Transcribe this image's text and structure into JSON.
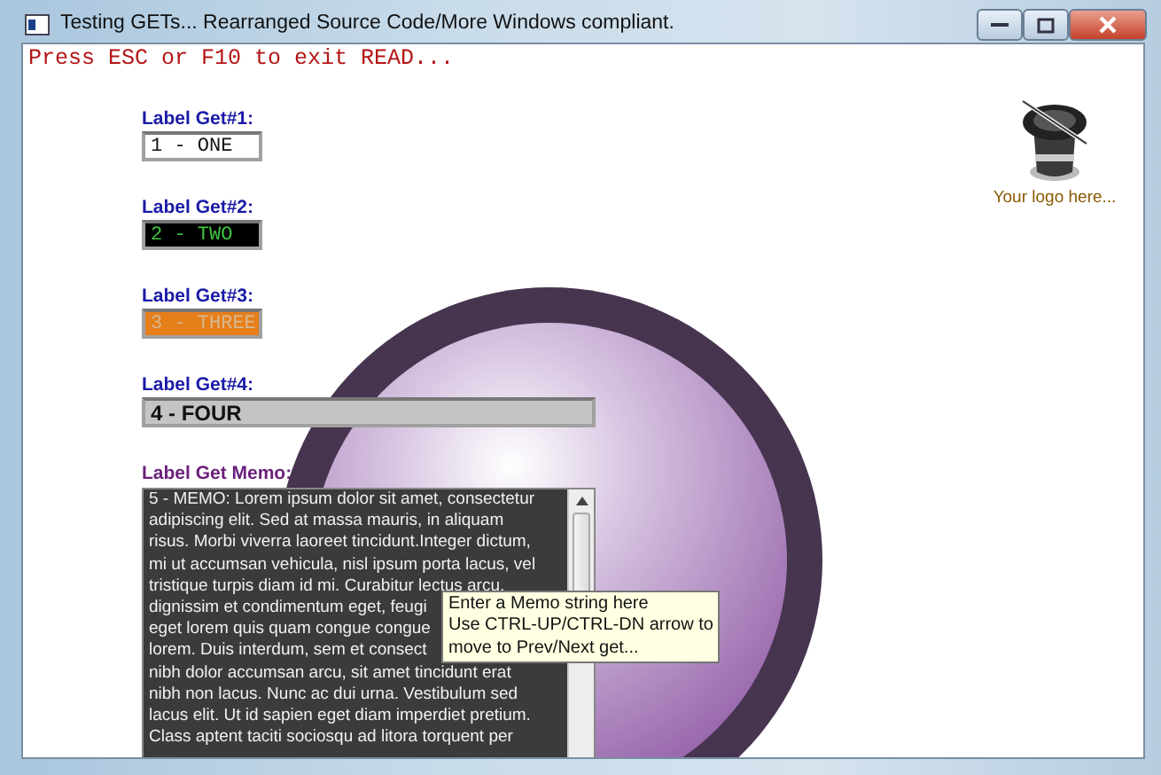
{
  "window": {
    "title": "Testing GETs... Rearranged Source Code/More Windows compliant."
  },
  "status_line": "Press ESC or F10 to exit READ...",
  "gets": [
    {
      "kind": "plain",
      "label": "Label Get#1:",
      "value": "1 - ONE"
    },
    {
      "kind": "dark",
      "label": "Label Get#2:",
      "value": "2 - TWO"
    },
    {
      "kind": "orange",
      "label": "Label Get#3:",
      "value": "3 - THREE"
    },
    {
      "kind": "bold",
      "label": "Label Get#4:",
      "value": "4 - FOUR"
    },
    {
      "kind": "memo",
      "label": "Label Get Memo:",
      "lines": [
        "5 - MEMO: Lorem ipsum dolor sit amet, consectetur",
        "adipiscing elit. Sed at massa mauris, in aliquam",
        "risus. Morbi viverra laoreet tincidunt.Integer dictum,",
        "mi ut accumsan vehicula, nisl ipsum porta lacus, vel",
        "tristique turpis diam id mi. Curabitur lectus arcu,",
        "dignissim et condimentum eget, feugi",
        "eget lorem quis quam congue congue",
        "lorem. Duis interdum, sem et consect",
        "nibh dolor accumsan arcu, sit amet tincidunt erat",
        "nibh non lacus. Nunc ac dui urna. Vestibulum sed",
        "lacus elit. Ut id sapien eget diam imperdiet pretium.",
        "Class aptent taciti sociosqu ad litora torquent per"
      ]
    }
  ],
  "tooltip": [
    "Enter a Memo string here",
    "Use CTRL-UP/CTRL-DN arrow to",
    "move to Prev/Next get..."
  ],
  "logo": {
    "caption": "Your logo here..."
  }
}
